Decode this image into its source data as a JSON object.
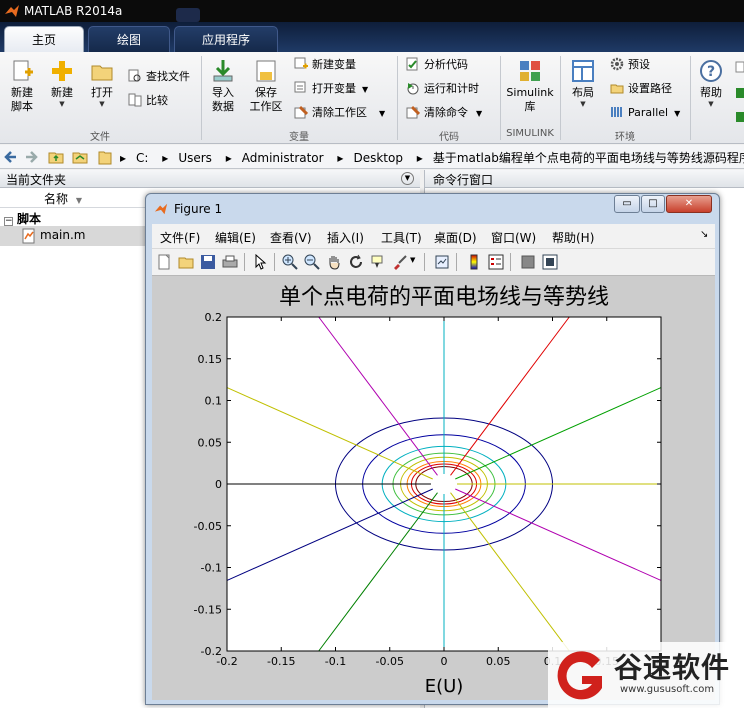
{
  "window": {
    "title": "MATLAB R2014a"
  },
  "tabs": [
    {
      "label": "主页",
      "active": true
    },
    {
      "label": "绘图",
      "active": false
    },
    {
      "label": "应用程序",
      "active": false
    }
  ],
  "ribbon": {
    "file": {
      "group": "文件",
      "new_script": [
        "新建",
        "脚本"
      ],
      "new": "新建",
      "open": "打开",
      "find_files": "查找文件",
      "compare": "比较"
    },
    "variable": {
      "group": "变量",
      "import": [
        "导入",
        "数据"
      ],
      "save_ws": [
        "保存",
        "工作区"
      ],
      "new_var": "新建变量",
      "open_var": "打开变量",
      "clear_ws": "清除工作区"
    },
    "code": {
      "group": "代码",
      "analyze": "分析代码",
      "run_time": "运行和计时",
      "clear_cmd": "清除命令"
    },
    "simulink": {
      "group": "SIMULINK",
      "label": [
        "Simulink",
        "库"
      ]
    },
    "env": {
      "group": "环境",
      "layout": "布局",
      "prefs": "预设",
      "set_path": "设置路径",
      "parallel": "Parallel"
    },
    "help": "帮助"
  },
  "address": {
    "crumbs": [
      "C:",
      "Users",
      "Administrator",
      "Desktop",
      "基于matlab编程单个点电荷的平面电场线与等势线源码程序"
    ]
  },
  "left_panel": {
    "title": "当前文件夹",
    "col_name": "名称",
    "folder": "脚本",
    "file": "main.m"
  },
  "cmd_panel": {
    "title": "命令行窗口"
  },
  "figure": {
    "title": "Figure 1",
    "menu": [
      "文件(F)",
      "编辑(E)",
      "查看(V)",
      "插入(I)",
      "工具(T)",
      "桌面(D)",
      "窗口(W)",
      "帮助(H)"
    ],
    "window_buttons": {
      "minimize": "▭",
      "maximize": "□",
      "close": "✕"
    }
  },
  "chart_data": {
    "type": "line",
    "title": "单个点电荷的平面电场线与等势线",
    "xlabel": "E(U)",
    "ylabel": "",
    "xlim": [
      -0.2,
      0.2
    ],
    "ylim": [
      -0.2,
      0.2
    ],
    "xticks": [
      -0.2,
      -0.15,
      -0.1,
      -0.05,
      0,
      0.05,
      0.1,
      0.15,
      0.2
    ],
    "yticks": [
      -0.2,
      -0.15,
      -0.1,
      -0.05,
      0,
      0.05,
      0.1,
      0.15,
      0.2
    ],
    "xtick_labels": [
      "-0.2",
      "-0.15",
      "-0.1",
      "-0.05",
      "0",
      "0.05",
      "0.1",
      "0.15",
      "0.2"
    ],
    "ytick_labels": [
      "-0.2",
      "-0.15",
      "-0.1",
      "-0.05",
      "0",
      "0.05",
      "0.1",
      "0.15",
      "0.2"
    ],
    "field_lines": {
      "angles_deg": [
        0,
        30,
        60,
        90,
        120,
        150,
        180,
        210,
        240,
        270,
        300,
        330
      ],
      "inner_radius": 0.012,
      "colors": [
        "#c0c000",
        "#00a000",
        "#e00000",
        "#00b0c0",
        "#b000b0",
        "#c0c000",
        "#000000",
        "#000080",
        "#008000",
        "#00b0c0",
        "#c0c000",
        "#b000b0"
      ]
    },
    "equipotentials": [
      {
        "rx": 0.1,
        "ry": 0.079,
        "color": "#000080"
      },
      {
        "rx": 0.075,
        "ry": 0.059,
        "color": "#0000a0"
      },
      {
        "rx": 0.057,
        "ry": 0.045,
        "color": "#00b0c0"
      },
      {
        "rx": 0.047,
        "ry": 0.037,
        "color": "#40c040"
      },
      {
        "rx": 0.04,
        "ry": 0.032,
        "color": "#c0c000"
      },
      {
        "rx": 0.034,
        "ry": 0.027,
        "color": "#ff8000"
      },
      {
        "rx": 0.03,
        "ry": 0.024,
        "color": "#e00000"
      },
      {
        "rx": 0.026,
        "ry": 0.021,
        "color": "#800000"
      }
    ],
    "grid": false
  },
  "watermark": {
    "text": "谷速软件",
    "url": "www.gususoft.com",
    "accent": "#d0211c"
  }
}
